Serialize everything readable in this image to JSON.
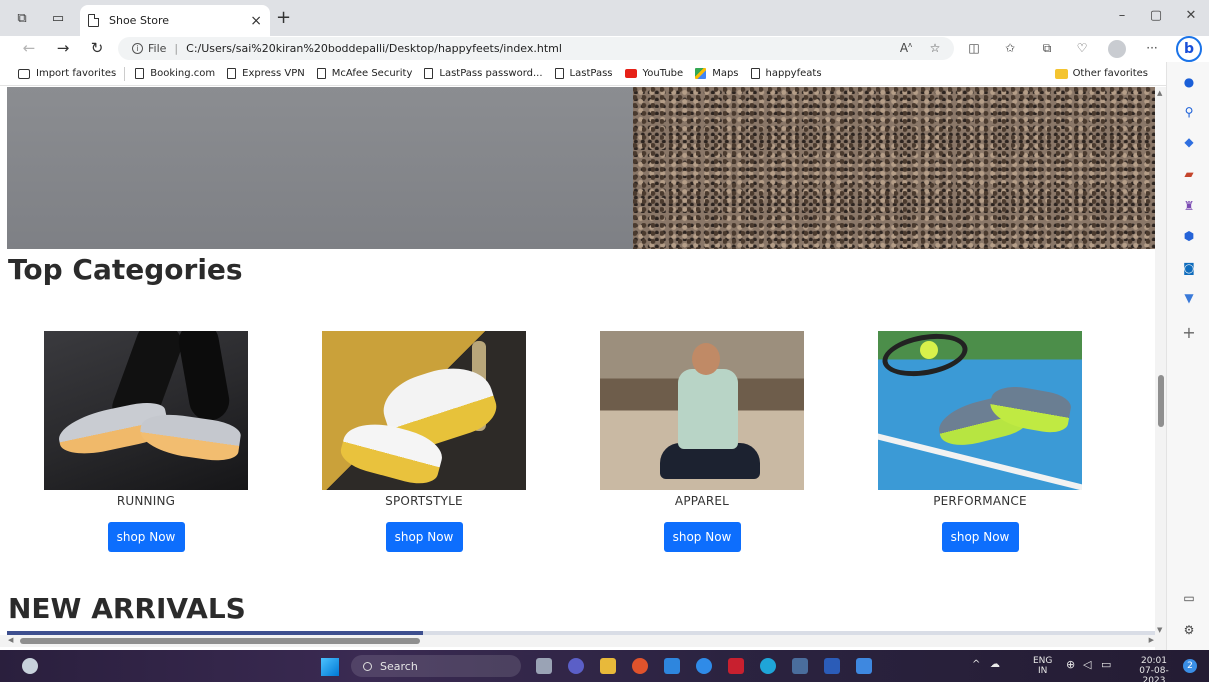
{
  "browser": {
    "tab_title": "Shoe Store",
    "tab_close": "×",
    "new_tab": "+",
    "address_label": "File",
    "address_url": "C:/Users/sai%20kiran%20boddepalli/Desktop/happyfeets/index.html",
    "more": "···",
    "bing_label": "b"
  },
  "favorites": {
    "items": [
      {
        "label": "Import favorites",
        "icon": "import-icon"
      },
      {
        "label": "Booking.com",
        "icon": "page-icon"
      },
      {
        "label": "Express VPN",
        "icon": "page-icon"
      },
      {
        "label": "McAfee Security",
        "icon": "page-icon"
      },
      {
        "label": "LastPass password...",
        "icon": "page-icon"
      },
      {
        "label": "LastPass",
        "icon": "page-icon"
      },
      {
        "label": "YouTube",
        "icon": "youtube-icon"
      },
      {
        "label": "Maps",
        "icon": "maps-icon"
      },
      {
        "label": "happyfeats",
        "icon": "page-icon"
      }
    ],
    "other": "Other favorites"
  },
  "page": {
    "categories_title": "Top Categories",
    "arrivals_title": "NEW ARRIVALS",
    "categories": [
      {
        "name": "RUNNING",
        "button": "shop Now"
      },
      {
        "name": "SPORTSTYLE",
        "button": "shop Now"
      },
      {
        "name": "APPAREL",
        "button": "shop Now"
      },
      {
        "name": "PERFORMANCE",
        "button": "shop Now"
      }
    ]
  },
  "taskbar": {
    "search_placeholder": "Search",
    "lang_line1": "ENG",
    "lang_line2": "IN",
    "time": "20:01",
    "date": "07-08-2023",
    "notifications": "2"
  },
  "colors": {
    "accent": "#0d6efd"
  }
}
